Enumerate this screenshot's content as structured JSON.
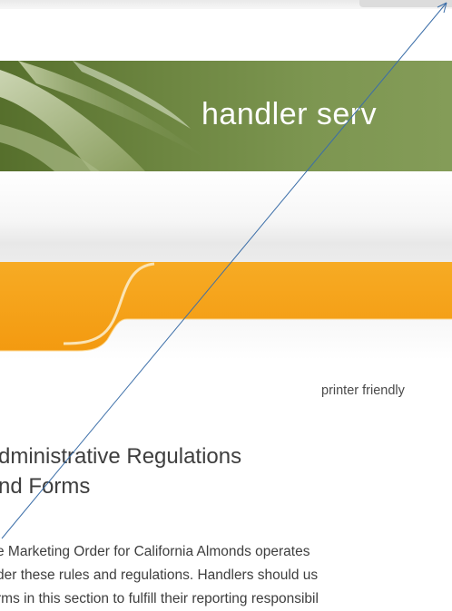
{
  "header": {
    "banner_title": "handler serv"
  },
  "toolbar": {
    "printer_link": "printer friendly"
  },
  "main": {
    "title_lines": [
      "dministrative Regulations",
      "nd Forms"
    ],
    "body_lines": [
      "e Marketing Order for California Almonds operates",
      "der these rules and regulations. Handlers should us",
      "rms in this section to fulfill their reporting responsibil"
    ]
  },
  "colors": {
    "banner_green": "#6c8540",
    "nav_orange": "#f7a81c",
    "annotation_line": "#3b6ea8"
  }
}
